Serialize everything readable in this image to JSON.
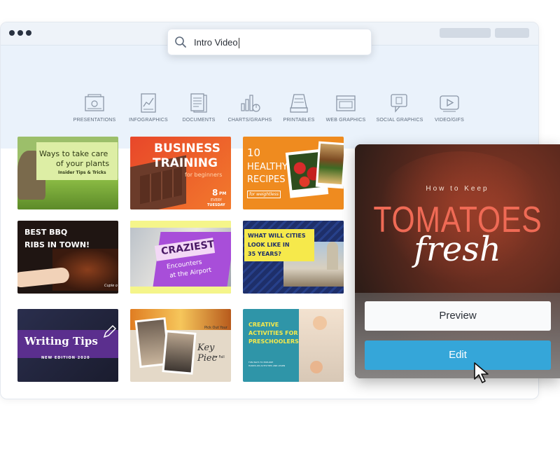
{
  "search": {
    "query": "Intro Video"
  },
  "categories": [
    "PRESENTATIONS",
    "INFOGRAPHICS",
    "DOCUMENTS",
    "CHARTS/GRAPHS",
    "PRINTABLES",
    "WEB GRAPHICS",
    "SOCIAL GRAPHICS",
    "VIDEO/GIFS"
  ],
  "templates": {
    "t1": {
      "line1": "Ways to take care",
      "line2": "of your plants",
      "line3": "Insider Tips & Tricks"
    },
    "t2": {
      "line1": "BUSINESS",
      "line2": "TRAINING",
      "line3": "for beginners",
      "num": "8",
      "pm": "PM",
      "every": "EVERY",
      "day": "TUESDAY"
    },
    "t3": {
      "line1": "10",
      "line2": "HEALTHY",
      "line3": "RECIPES",
      "line4": "for weightless"
    },
    "t4": {
      "line1": "BEST BBQ",
      "line2": "RIBS IN TOWN!",
      "line3": "Cuple o"
    },
    "t5": {
      "line1": "CRAZIEST",
      "line2": "Encounters",
      "line3": "at the Airport"
    },
    "t6": {
      "line1": "WHAT WILL CITIES",
      "line2": "LOOK LIKE IN",
      "line3": "35 YEARS?"
    },
    "t7": {
      "line1": "Writing Tips",
      "line2": "NEW EDITION 2020"
    },
    "t8": {
      "line1": "Pick Out Your",
      "line2": "Key Piec",
      "line3": "for Fall"
    },
    "t9": {
      "line1": "CREATIVE",
      "line2": "ACTIVITIES FOR",
      "line3": "PRESCHOOLERS",
      "line4": "FUN WAYS TO EXPLORE",
      "line5": "HANDS-ON ACTIVITIES AND LEARN"
    }
  },
  "card": {
    "small": "How to Keep",
    "big": "TOMATOES",
    "script": "fresh",
    "preview": "Preview",
    "edit": "Edit"
  }
}
